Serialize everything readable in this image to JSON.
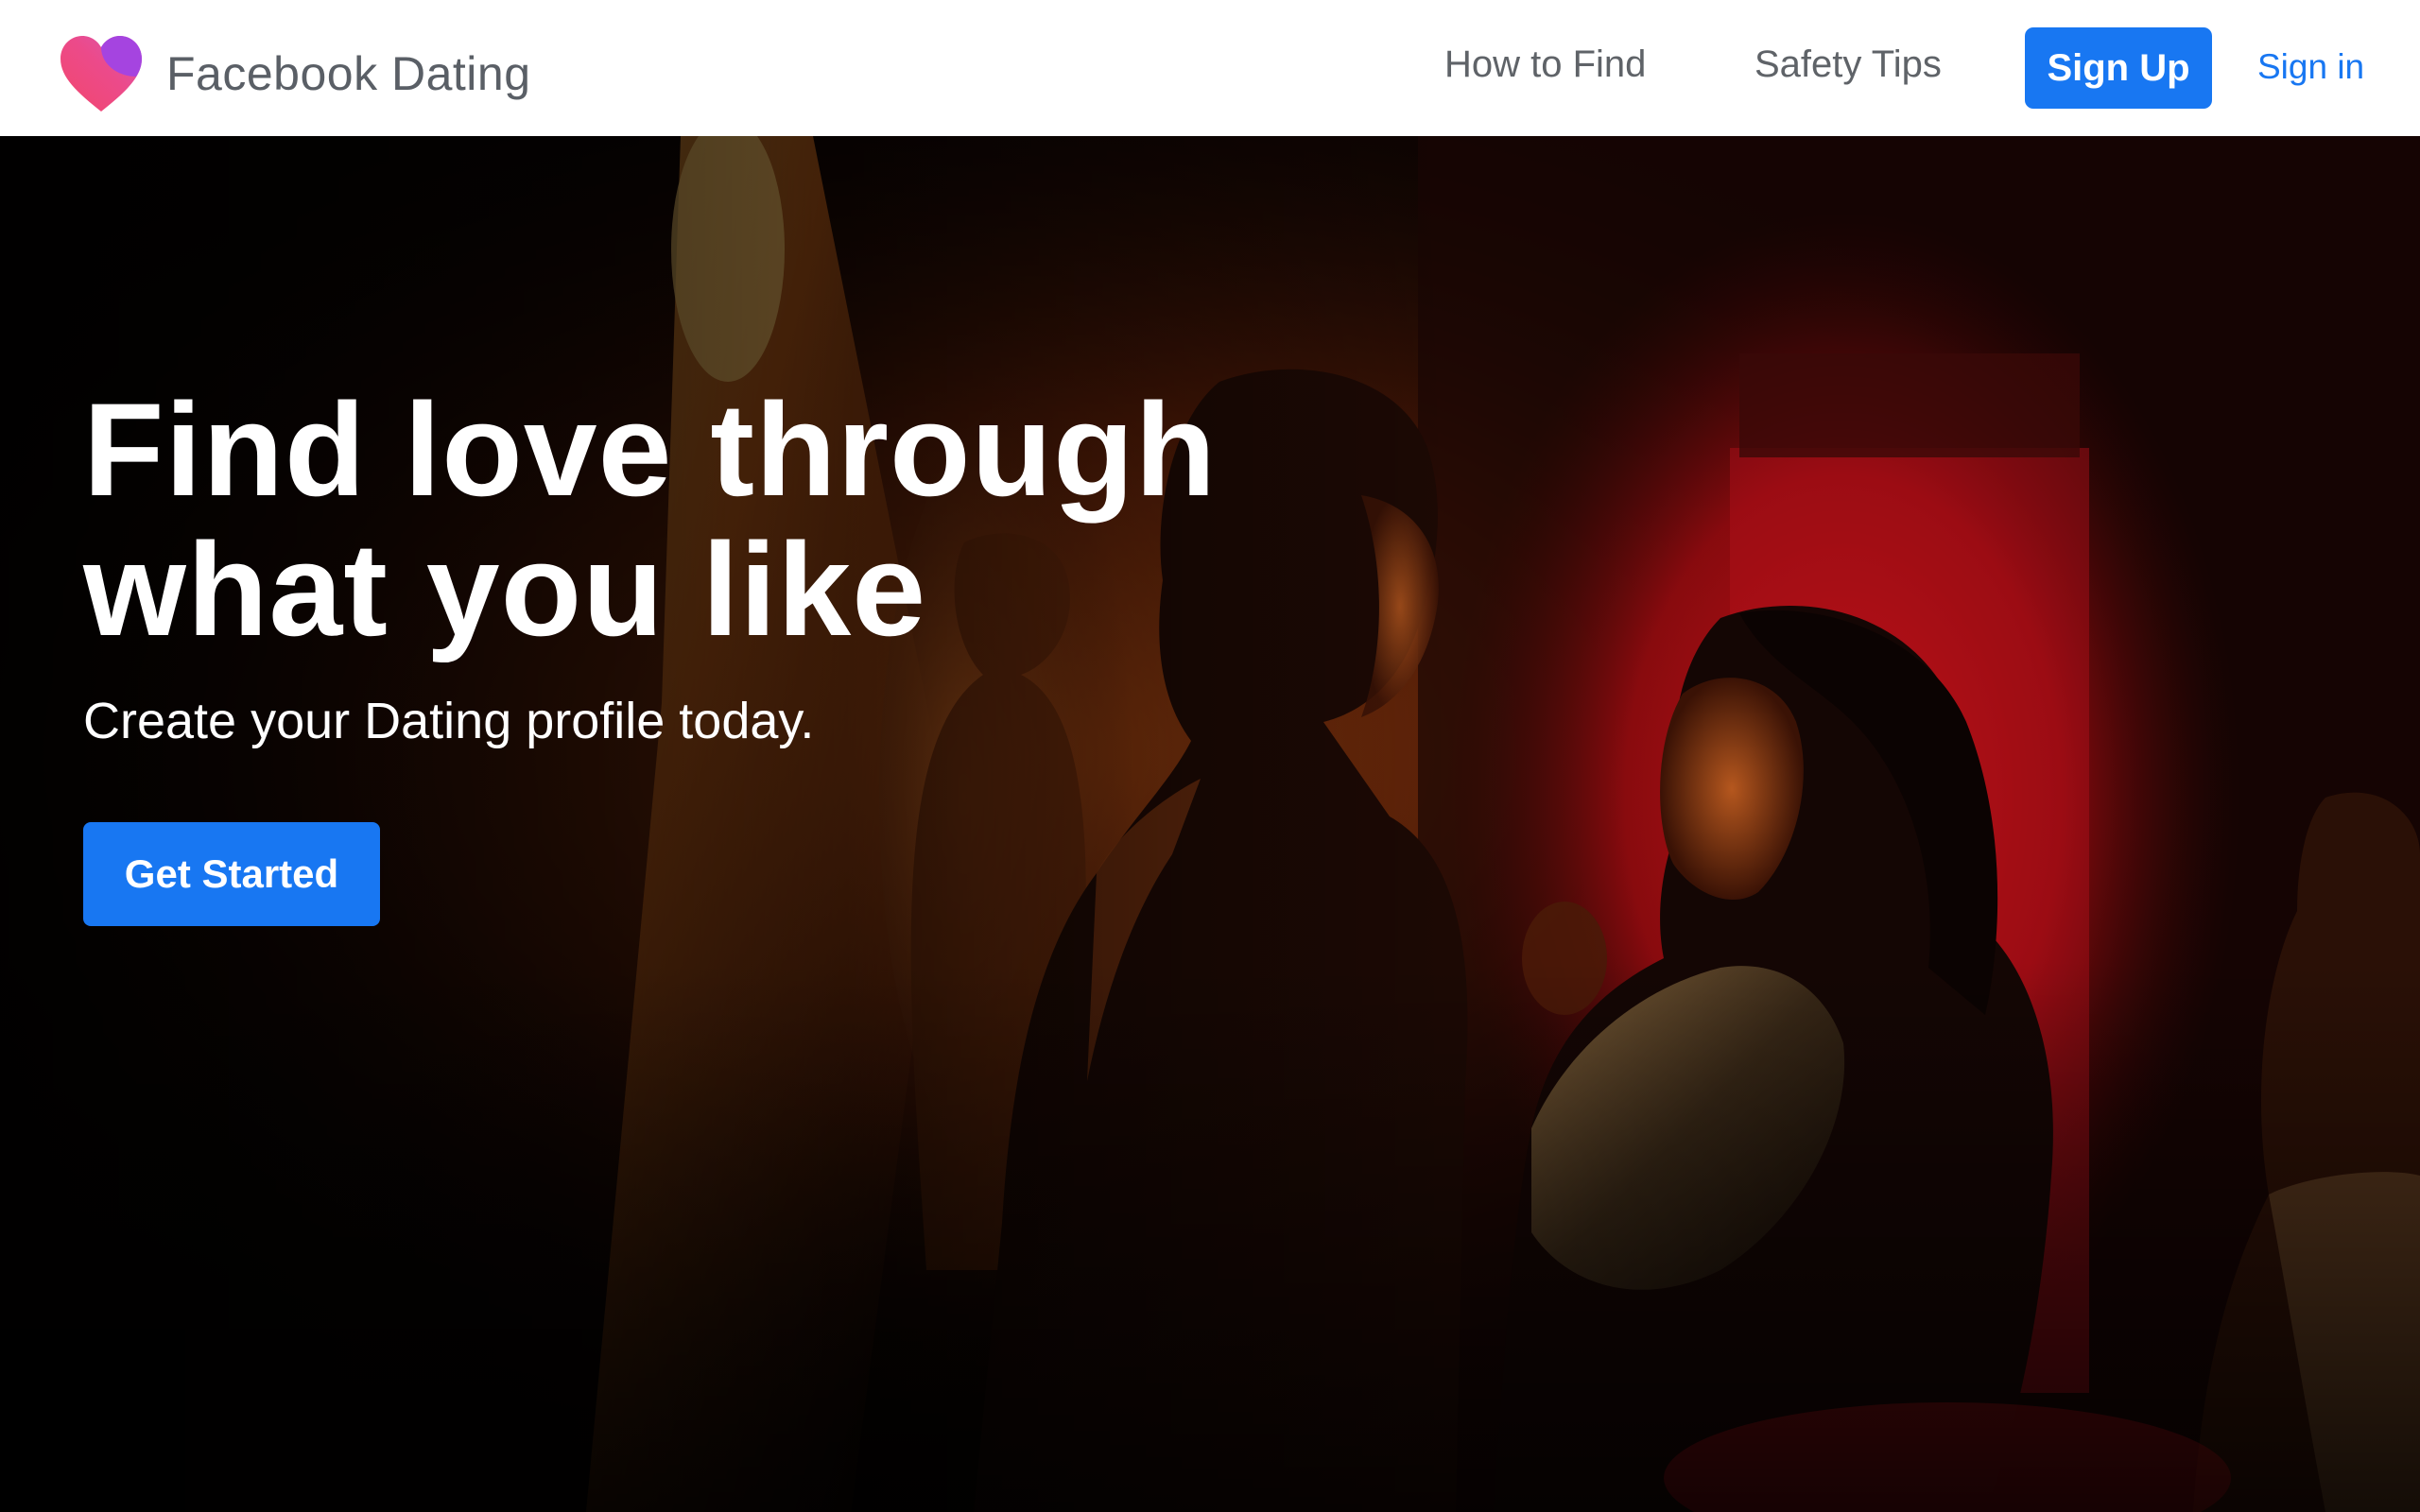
{
  "header": {
    "brand": {
      "name": "Facebook Dating",
      "logo_icon": "heart-icon",
      "logo_colors": [
        "#f0436f",
        "#a544e0"
      ]
    },
    "nav": {
      "how_to_find": "How to Find",
      "safety_tips": "Safety Tips"
    },
    "signup_label": "Sign Up",
    "signin_label": "Sign in"
  },
  "hero": {
    "title": "Find love through\nwhat you like",
    "subtitle": "Create your Dating profile today.",
    "cta_label": "Get Started",
    "photo_alt": "Couple dancing in a dimly lit, red and orange lit venue"
  },
  "colors": {
    "accent": "#1877f2",
    "header_bg": "#ffffff",
    "brand_text": "#5a5f66",
    "nav_text": "#5f6368",
    "hero_text": "#ffffff"
  }
}
